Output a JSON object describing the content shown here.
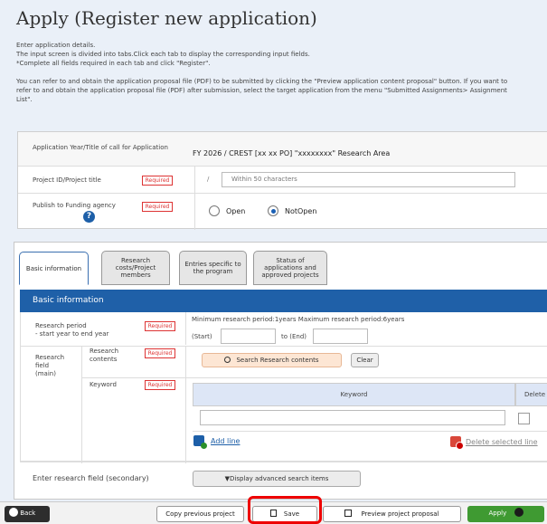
{
  "page": {
    "title": "Apply (Register new application)",
    "intro": [
      "Enter application details.",
      "The input screen is divided into tabs.Click each tab to display the corresponding input fields.",
      "*Complete all fields required in each tab and click \"Register\".",
      "You can refer to and obtain the application proposal file (PDF) to be submitted by clicking the \"Preview application content proposal\" button. If you want to",
      "refer to and obtain the application proposal file (PDF) after submission, select the target application from the menu \"Submitted Assignments> Assignment",
      "List\"."
    ]
  },
  "call": {
    "year_title_label": "Application Year/Title of call for Application",
    "year_title_value": "FY 2026 / CREST [xx xx PO] \"xxxxxxxx\" Research Area",
    "project_label": "Project ID/Project title",
    "project_prefix": "/",
    "project_placeholder": "Within 50 characters",
    "publish_label": "Publish to Funding agency",
    "publish_options": [
      "Open",
      "NotOpen"
    ],
    "publish_selected": "NotOpen",
    "required_label": "Required"
  },
  "tabs": [
    {
      "label": "Basic information",
      "active": true
    },
    {
      "label": "Research costs/Project members",
      "active": false
    },
    {
      "label": "Entries specific to the program",
      "active": false
    },
    {
      "label": "Status of applications and approved projects",
      "active": false
    }
  ],
  "basic": {
    "section_title": "Basic information",
    "period_label_1": "Research period",
    "period_label_2": "- start year to end year",
    "period_hint": "Minimum research period:1years   Maximum research period:6years",
    "start_label": "(Start)",
    "end_label": "to (End)",
    "field_main_label": "Research field (main)",
    "contents_label": "Research contents",
    "search_button": "Search Research contents",
    "clear_button": "Clear",
    "keyword_label": "Keyword",
    "keyword_col": "Keyword",
    "delete_col": "Delete",
    "add_line": "Add line",
    "delete_selected_line": "Delete selected line",
    "field_secondary_label": "Enter research field (secondary)",
    "advanced_button": "▼Display advanced search items"
  },
  "footer": {
    "back": "Back",
    "copy_previous": "Copy previous project",
    "save": "Save",
    "preview": "Preview project proposal",
    "apply": "Apply"
  },
  "colors": {
    "accent": "#1f60a8",
    "required": "#dd3333",
    "apply": "#3f9a32",
    "highlight": "#ee0000"
  }
}
